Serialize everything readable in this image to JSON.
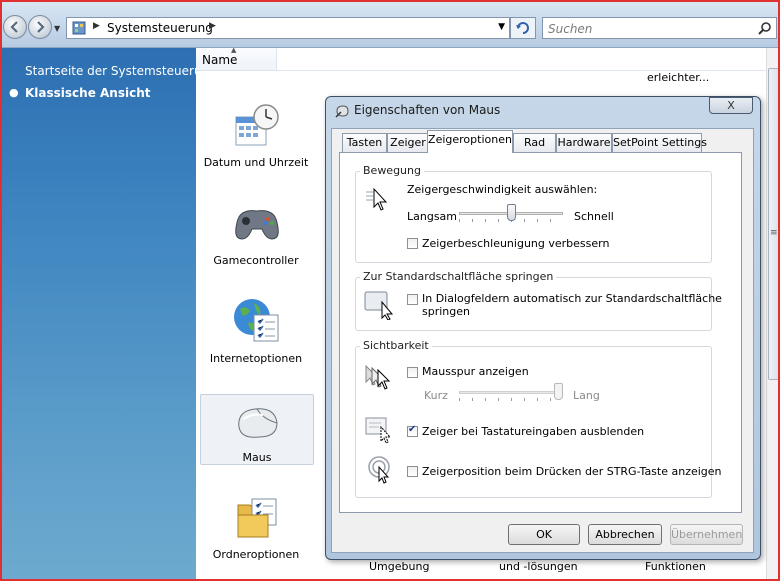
{
  "window": {
    "address": {
      "crumb": "Systemsteuerung"
    },
    "search": {
      "placeholder": "Suchen"
    }
  },
  "leftnav": {
    "link_home": "Startseite der Systemsteuerung",
    "link_classic": "Klassische Ansicht"
  },
  "content": {
    "column_name": "Name",
    "partial_top": "erleichter...",
    "items": [
      {
        "label": "Datum und Uhrzeit"
      },
      {
        "label": "Gamecontroller"
      },
      {
        "label": "Internetoptionen"
      },
      {
        "label": "Maus"
      },
      {
        "label": "Ordneroptionen"
      }
    ],
    "partial_bottom": [
      "Umgebung",
      "und -lösungen",
      "Funktionen"
    ]
  },
  "dialog": {
    "title": "Eigenschaften von Maus",
    "close_label": "X",
    "tabs": [
      "Tasten",
      "Zeiger",
      "Zeigeroptionen",
      "Rad",
      "Hardware",
      "SetPoint Settings"
    ],
    "active_tab": "Zeigeroptionen",
    "motion": {
      "title": "Bewegung",
      "speed_label": "Zeigergeschwindigkeit auswählen:",
      "slow": "Langsam",
      "fast": "Schnell",
      "speed_value": 0.5,
      "enhance_label": "Zeigerbeschleunigung verbessern",
      "enhance_checked": false
    },
    "snap": {
      "title": "Zur Standardschaltfläche springen",
      "label_line1": "In Dialogfeldern automatisch zur Standardschaltfläche",
      "label_line2": "springen",
      "checked": false
    },
    "visibility": {
      "title": "Sichtbarkeit",
      "trails_label": "Mausspur anzeigen",
      "trails_checked": false,
      "short": "Kurz",
      "long": "Lang",
      "trails_value": 1.0,
      "hide_label": "Zeiger bei Tastatureingaben ausblenden",
      "hide_checked": true,
      "ctrl_label": "Zeigerposition beim Drücken der STRG-Taste anzeigen",
      "ctrl_checked": false
    },
    "buttons": {
      "ok": "OK",
      "cancel": "Abbrechen",
      "apply": "Übernehmen"
    }
  }
}
